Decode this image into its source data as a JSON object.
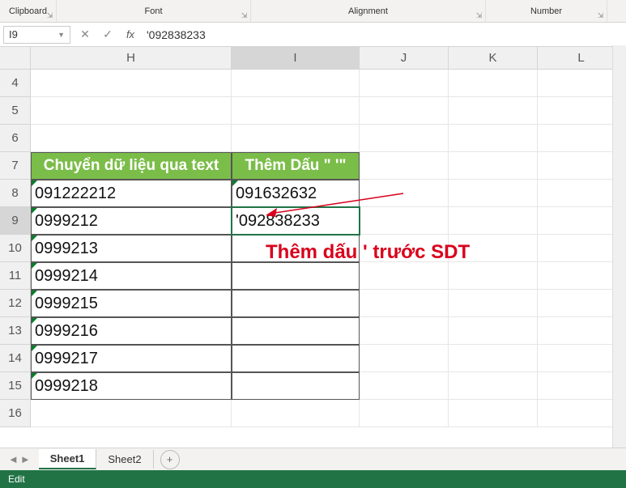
{
  "ribbon": {
    "clipboard": "Clipboard",
    "font": "Font",
    "alignment": "Alignment",
    "number": "Number"
  },
  "formula_bar": {
    "name_box": "I9",
    "cancel": "✕",
    "enter": "✓",
    "fx": "fx",
    "value": "'092838233"
  },
  "columns": [
    "H",
    "I",
    "J",
    "K",
    "L"
  ],
  "rows": [
    "4",
    "5",
    "6",
    "7",
    "8",
    "9",
    "10",
    "11",
    "12",
    "13",
    "14",
    "15",
    "16"
  ],
  "active": {
    "row": "9",
    "col": "I"
  },
  "data": {
    "H7": "Chuyển dữ liệu qua text",
    "I7": "Thêm Dấu \" '\"",
    "H8": "091222212",
    "I8": "091632632",
    "H9": "0999212",
    "I9": "'092838233",
    "H10": "0999213",
    "H11": "0999214",
    "H12": "0999215",
    "H13": "0999216",
    "H14": "0999217",
    "H15": "0999218"
  },
  "annotation": "Thêm dấu ' trước SDT",
  "tabs": {
    "sheet1": "Sheet1",
    "sheet2": "Sheet2",
    "new": "+",
    "nav_prev": "◄",
    "nav_next": "►"
  },
  "status": "Edit"
}
